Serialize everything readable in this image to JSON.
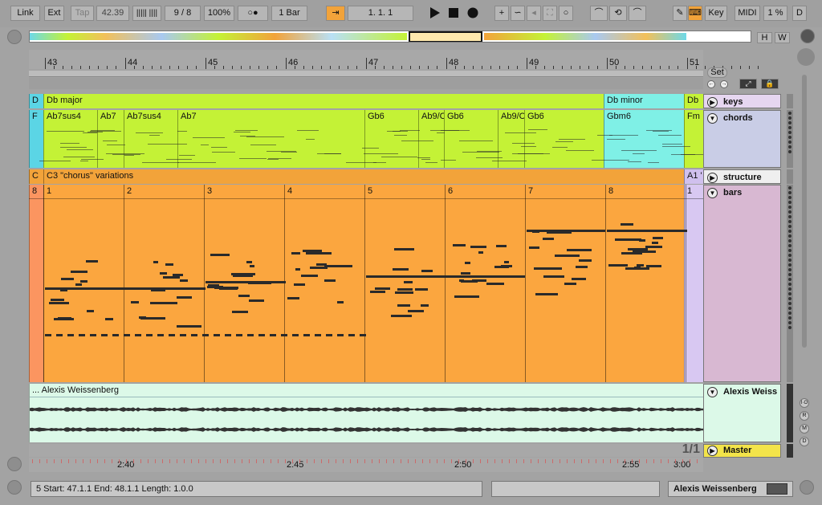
{
  "toolbar": {
    "link": "Link",
    "ext": "Ext",
    "tap": "Tap",
    "tempo": "42.39",
    "signature_num": "9",
    "signature_sep": "/",
    "signature_den": "8",
    "zoom": "100%",
    "metronome": "○●",
    "quantize": "1 Bar",
    "position": "1.   1.   1",
    "key": "Key",
    "midi": "MIDI",
    "cpu": "1 %",
    "d": "D",
    "h": "H",
    "w": "W"
  },
  "ruler": {
    "bars": [
      "43",
      "44",
      "45",
      "46",
      "47",
      "48",
      "49",
      "50",
      "51"
    ],
    "set_label": "Set"
  },
  "tracks": {
    "keys": {
      "name": "keys",
      "clips": [
        "D",
        "Db major",
        "Db minor",
        "Db"
      ]
    },
    "chords": {
      "name": "chords",
      "clips": [
        "F",
        "Ab7sus4",
        "Ab7",
        "Ab7sus4",
        "Ab7",
        "Gb6",
        "Ab9/C",
        "Gb6",
        "Ab9/C",
        "Gb6",
        "Gbm6",
        "Fm"
      ]
    },
    "structure": {
      "name": "structure",
      "clips": [
        "C",
        "C3 \"chorus\" variations",
        "A1 '"
      ]
    },
    "bars": {
      "name": "bars",
      "labels": [
        "8",
        "1",
        "2",
        "3",
        "4",
        "5",
        "6",
        "7",
        "8",
        "1"
      ]
    },
    "audio": {
      "name": "Alexis Weiss",
      "clip": "... Alexis Weissenberg"
    },
    "master": {
      "name": "Master",
      "page": "1/1"
    }
  },
  "bottom_ruler": {
    "times": [
      "2:40",
      "2:45",
      "2:50",
      "2:55",
      "3:00"
    ]
  },
  "side_buttons": [
    "I·O",
    "R",
    "M",
    "D"
  ],
  "status": {
    "selection": "5  Start: 47.1.1  End: 48.1.1  Length: 1.0.0",
    "device": "Alexis Weissenberg"
  },
  "colors": {
    "orange_accent": "#f2a33a",
    "keys_clip": "#c4f236",
    "chords_clip": "#c4f236",
    "minor_clip": "#7ff0e6",
    "structure_clip": "#f2a33a",
    "bars_clip": "#fba63f",
    "audio_clip": "#dcf9e8",
    "master_yellow": "#f3e44a"
  }
}
